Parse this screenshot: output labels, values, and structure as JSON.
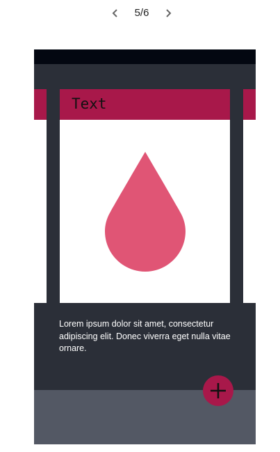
{
  "pager": {
    "label": "5/6",
    "prev_icon": "chevron-left-icon",
    "next_icon": "chevron-right-icon"
  },
  "card": {
    "title": "Text",
    "image_icon": "water-drop-icon"
  },
  "content": {
    "body": "Lorem ipsum dolor sit amet, consectetur adipiscing elit. Donec viverra eget nulla vitae ornare."
  },
  "fab": {
    "icon": "plus-icon"
  },
  "colors": {
    "accent": "#a8184a",
    "drop": "#e05575",
    "phone_background": "#2b2f38",
    "status_bar": "#030711",
    "bottom_area": "#535864"
  }
}
